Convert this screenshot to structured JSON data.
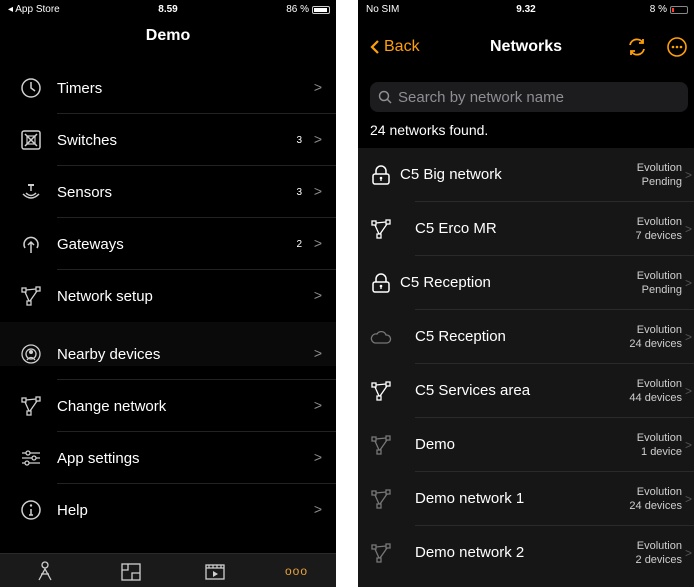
{
  "left": {
    "status": {
      "left": "◂ App Store",
      "time": "8.59",
      "battery": "86 %"
    },
    "title": "Demo",
    "menu": [
      {
        "label": "Timers",
        "count": "",
        "icon": "clock-icon"
      },
      {
        "label": "Switches",
        "count": "3",
        "icon": "switch-icon"
      },
      {
        "label": "Sensors",
        "count": "3",
        "icon": "sensor-icon"
      },
      {
        "label": "Gateways",
        "count": "2",
        "icon": "gateway-icon"
      },
      {
        "label": "Network setup",
        "count": "",
        "icon": "network-icon"
      }
    ],
    "menu2": [
      {
        "label": "Nearby devices",
        "icon": "nearby-icon"
      },
      {
        "label": "Change network",
        "icon": "network-icon"
      },
      {
        "label": "App settings",
        "icon": "sliders-icon"
      },
      {
        "label": "Help",
        "icon": "info-icon"
      }
    ],
    "tabs": [
      "person-icon",
      "floorplan-icon",
      "scene-icon",
      "more-icon"
    ],
    "more_glyph": "ooo",
    "chevron": ">"
  },
  "right": {
    "status": {
      "left": "No SIM",
      "time": "9.32",
      "battery": "8 %"
    },
    "back_label": "Back",
    "title": "Networks",
    "search_placeholder": "Search by network name",
    "found_text": "24 networks found.",
    "networks": [
      {
        "name": "C5 Big network",
        "type": "Evolution",
        "status": "Pending",
        "icon": "lock-icon"
      },
      {
        "name": "C5 Erco MR",
        "type": "Evolution",
        "status": "7 devices",
        "icon": "network-icon"
      },
      {
        "name": "C5 Reception",
        "type": "Evolution",
        "status": "Pending",
        "icon": "lock-icon"
      },
      {
        "name": "C5 Reception",
        "type": "Evolution",
        "status": "24 devices",
        "icon": "cloud-icon"
      },
      {
        "name": "C5 Services area",
        "type": "Evolution",
        "status": "44 devices",
        "icon": "network-icon"
      },
      {
        "name": "Demo",
        "type": "Evolution",
        "status": "1 device",
        "icon": "network-dim-icon"
      },
      {
        "name": "Demo network 1",
        "type": "Evolution",
        "status": "24 devices",
        "icon": "network-dim-icon"
      },
      {
        "name": "Demo network 2",
        "type": "Evolution",
        "status": "2 devices",
        "icon": "network-dim-icon"
      }
    ],
    "colors": {
      "accent": "#ff9f0a",
      "background": "#000000",
      "list": "#161616"
    }
  }
}
